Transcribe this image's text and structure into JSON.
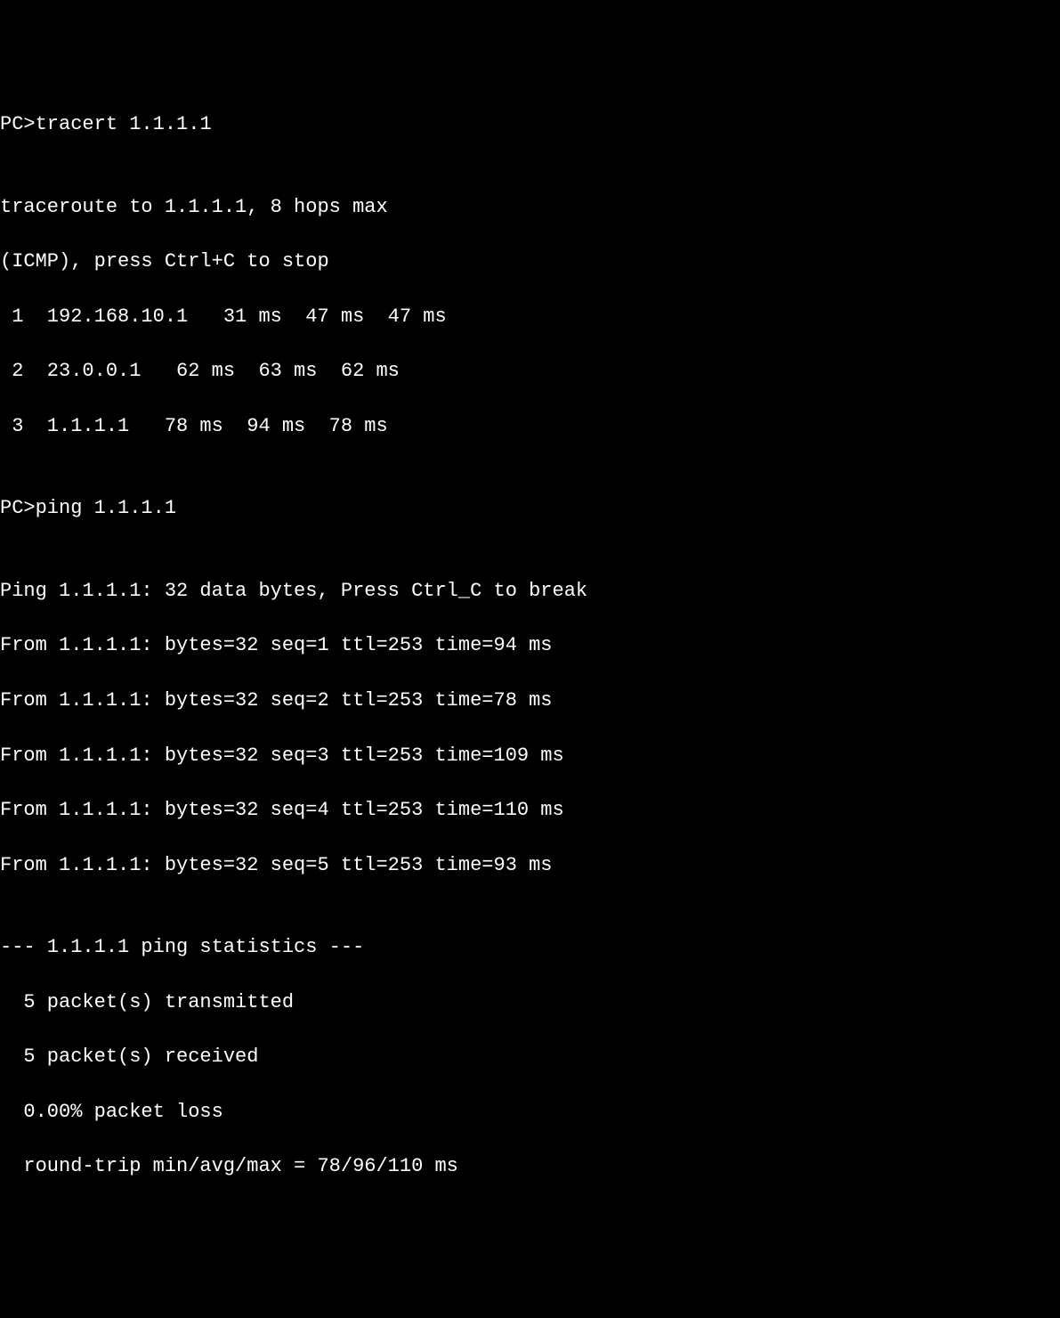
{
  "prompt1": "PC>",
  "cmd1": "tracert 1.1.1.1",
  "blank": "",
  "trace_header1": "traceroute to 1.1.1.1, 8 hops max",
  "trace_header2": "(ICMP), press Ctrl+C to stop",
  "hop1": " 1  192.168.10.1   31 ms  47 ms  47 ms",
  "hop2": " 2  23.0.0.1   62 ms  63 ms  62 ms",
  "hop3": " 3  1.1.1.1   78 ms  94 ms  78 ms",
  "prompt2": "PC>",
  "cmd2": "ping 1.1.1.1",
  "ping_header": "Ping 1.1.1.1: 32 data bytes, Press Ctrl_C to break",
  "reply1": "From 1.1.1.1: bytes=32 seq=1 ttl=253 time=94 ms",
  "reply2": "From 1.1.1.1: bytes=32 seq=2 ttl=253 time=78 ms",
  "reply3": "From 1.1.1.1: bytes=32 seq=3 ttl=253 time=109 ms",
  "reply4": "From 1.1.1.1: bytes=32 seq=4 ttl=253 time=110 ms",
  "reply5": "From 1.1.1.1: bytes=32 seq=5 ttl=253 time=93 ms",
  "stats_header": "--- 1.1.1.1 ping statistics ---",
  "stats_tx": "  5 packet(s) transmitted",
  "stats_rx": "  5 packet(s) received",
  "stats_loss": "  0.00% packet loss",
  "stats_rtt": "  round-trip min/avg/max = 78/96/110 ms"
}
